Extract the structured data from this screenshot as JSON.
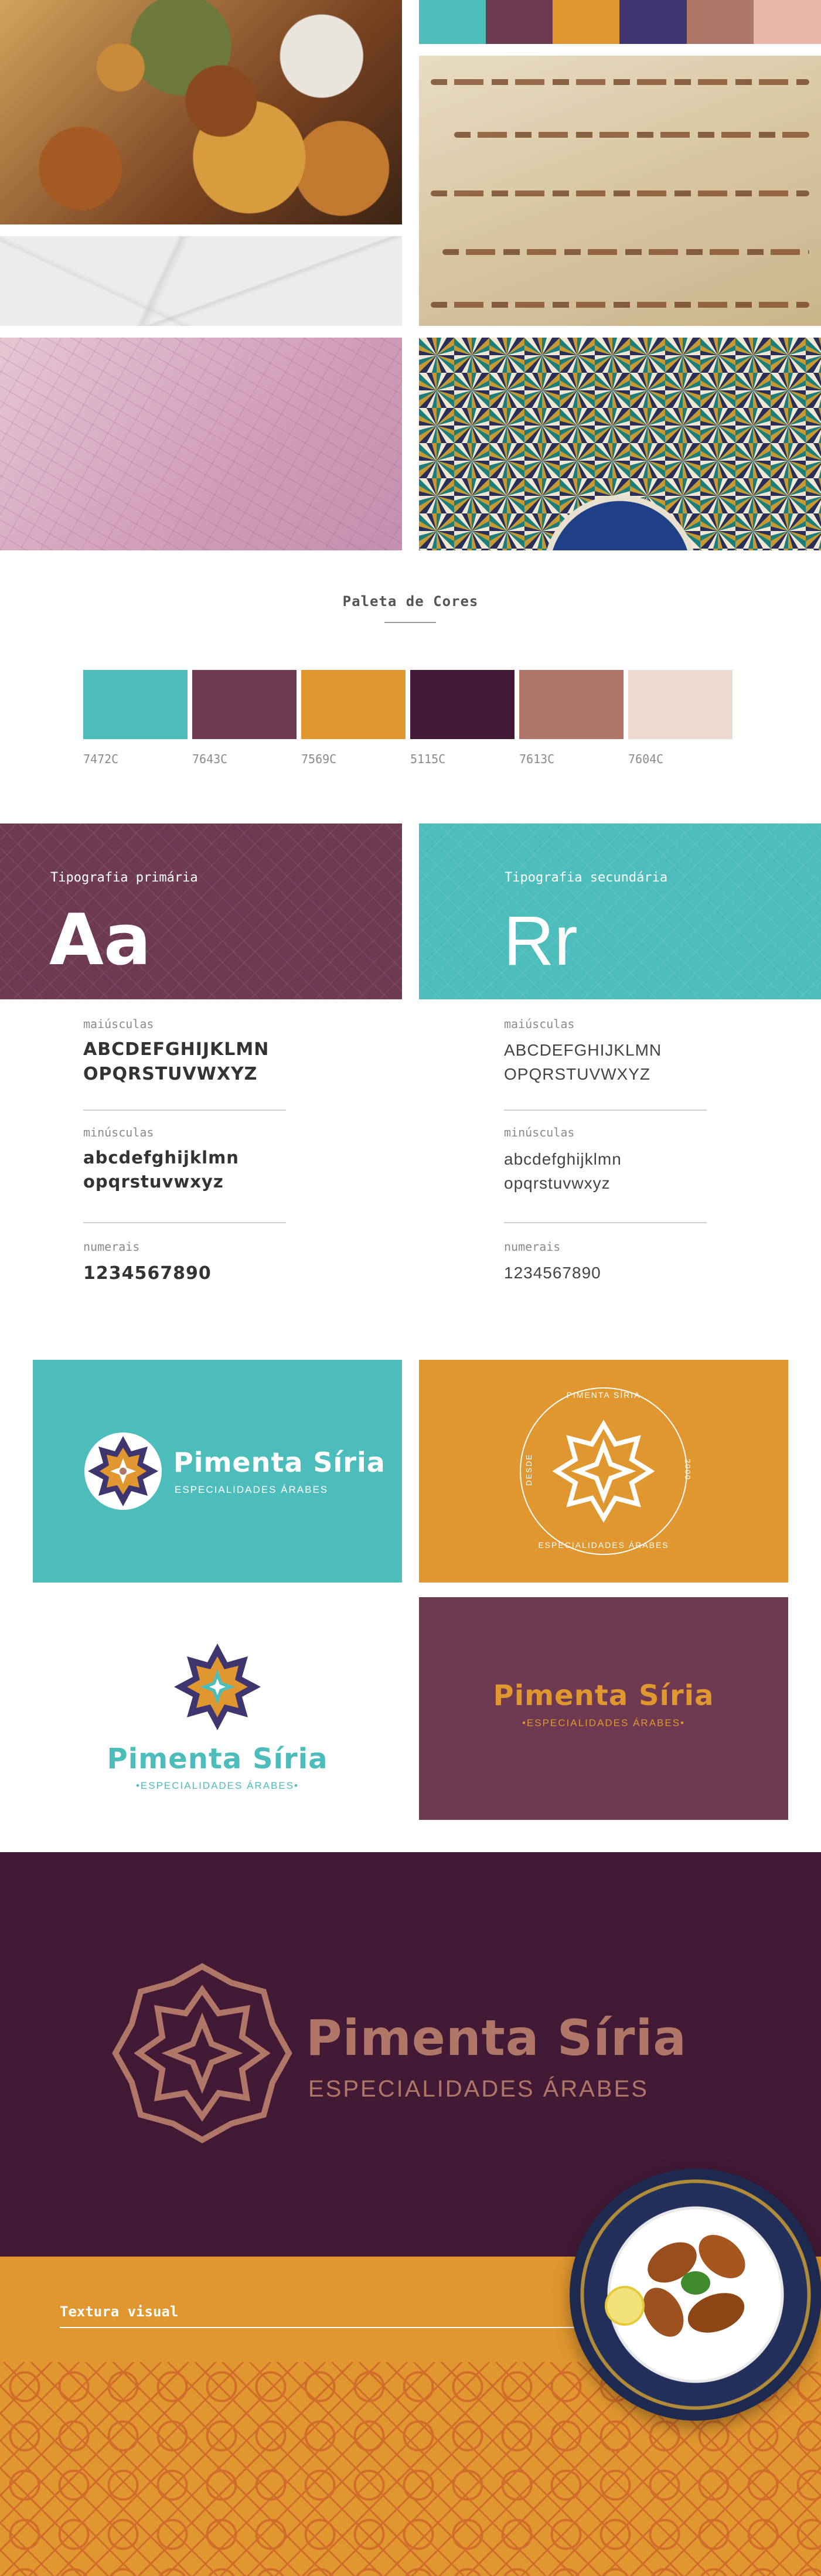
{
  "colors": {
    "teal": "#4dbdbc",
    "plum": "#6e3a52",
    "orange": "#e1972f",
    "aubergine": "#431a36",
    "rose": "#b07768",
    "blush": "#ecd9d1",
    "indigo": "#40366f"
  },
  "moodboard": {
    "tiles": [
      {
        "name": "food-photo"
      },
      {
        "name": "arabic-script-photo"
      },
      {
        "name": "marble-photo"
      },
      {
        "name": "map-photo"
      },
      {
        "name": "mosaic-tiles-photo"
      }
    ]
  },
  "palette": {
    "title": "Paleta de Cores",
    "swatches": [
      {
        "code": "7472C",
        "color": "#4dbdbc"
      },
      {
        "code": "7643C",
        "color": "#6e3a52"
      },
      {
        "code": "7569C",
        "color": "#e1972f"
      },
      {
        "code": "5115C",
        "color": "#431a36"
      },
      {
        "code": "7613C",
        "color": "#b07768"
      },
      {
        "code": "7604C",
        "color": "#ecd9d1"
      }
    ]
  },
  "typography": {
    "primary": {
      "caption": "Tipografia primária",
      "sample": "Aa",
      "upper_label": "maiúsculas",
      "upper_line1": "ABCDEFGHIJKLMN",
      "upper_line2": "OPQRSTUVWXYZ",
      "lower_label": "minúsculas",
      "lower_line1": "abcdefghijklmn",
      "lower_line2": "opqrstuvwxyz",
      "num_label": "numerais",
      "numbers": "1234567890"
    },
    "secondary": {
      "caption": "Tipografia secundária",
      "sample": "Rr",
      "upper_label": "maiúsculas",
      "upper_line1": "ABCDEFGHIJKLMN",
      "upper_line2": "OPQRSTUVWXYZ",
      "lower_label": "minúsculas",
      "lower_line1": "abcdefghijklmn",
      "lower_line2": "opqrstuvwxyz",
      "num_label": "numerais",
      "numbers": "1234567890"
    }
  },
  "logos": {
    "brand": "Pimenta Síria",
    "tagline": "ESPECIALIDADES ÁRABES",
    "tagline_decorated": "•ESPECIALIDADES ÁRABES•",
    "seal_top": "PIMENTA SÍRIA",
    "seal_bottom": "ESPECIALIDADES ÁRABES",
    "seal_left": "DESDE",
    "seal_right": "2000"
  },
  "hero": {
    "brand": "Pimenta Síria",
    "tagline": "ESPECIALIDADES ÁRABES"
  },
  "texture": {
    "label": "Textura visual"
  }
}
